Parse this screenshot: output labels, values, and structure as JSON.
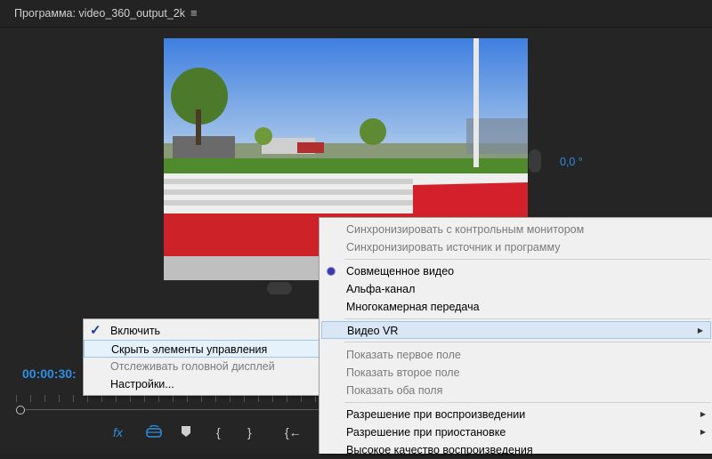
{
  "panel": {
    "title": "Программа: video_360_output_2k",
    "menu_icon": "≡"
  },
  "vr": {
    "angle": "0,0 °"
  },
  "timecode": "00:00:30:",
  "controls": {
    "fx": "fx",
    "vr_icon": "vr-goggles-icon",
    "marker": "marker-icon",
    "in": "{",
    "out": "}",
    "goto_in": "{←"
  },
  "left_menu": {
    "items": [
      {
        "label": "Включить",
        "checked": true,
        "disabled": false
      },
      {
        "label": "Скрыть элементы управления",
        "checked": false,
        "disabled": false
      },
      {
        "label": "Отслеживать головной дисплей",
        "checked": false,
        "disabled": true
      },
      {
        "label": "Настройки...",
        "checked": false,
        "disabled": false
      }
    ]
  },
  "right_menu": {
    "items": [
      {
        "label": "Синхронизировать с контрольным монитором",
        "disabled": true
      },
      {
        "label": "Синхронизировать источник и программу",
        "disabled": true
      },
      {
        "label": "Совмещенное видео",
        "selected": true
      },
      {
        "label": "Альфа-канал"
      },
      {
        "label": "Многокамерная передача"
      },
      {
        "label": "Видео VR",
        "submenu": true
      },
      {
        "label": "Показать первое поле",
        "disabled": true
      },
      {
        "label": "Показать второе поле",
        "disabled": true
      },
      {
        "label": "Показать оба поля",
        "disabled": true
      },
      {
        "label": "Разрешение при воспроизведении",
        "submenu": true
      },
      {
        "label": "Разрешение при приостановке",
        "submenu": true
      },
      {
        "label": "Высокое качество воспроизведения"
      }
    ]
  }
}
